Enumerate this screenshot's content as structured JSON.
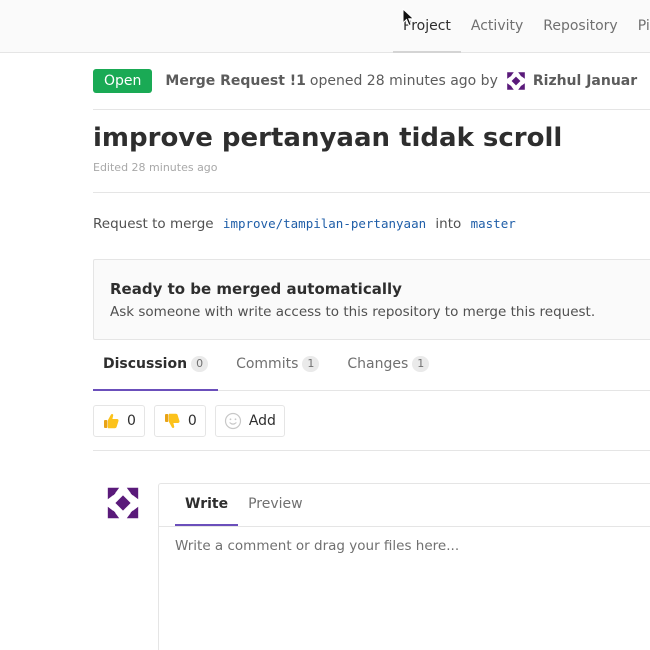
{
  "topnav": {
    "items": [
      {
        "label": "Project",
        "active": true
      },
      {
        "label": "Activity",
        "active": false
      },
      {
        "label": "Repository",
        "active": false
      },
      {
        "label": "Pipe",
        "active": false
      }
    ]
  },
  "mr": {
    "status": "Open",
    "ref": "Merge Request !1",
    "meta": "opened 28 minutes ago by",
    "author": "Rizhul Januar",
    "title": "improve pertanyaan tidak scroll",
    "edited": "Edited 28 minutes ago"
  },
  "merge_info": {
    "prefix": "Request to merge",
    "source_branch": "improve/tampilan-pertanyaan",
    "into": "into",
    "target_branch": "master"
  },
  "merge_widget": {
    "title": "Ready to be merged automatically",
    "description": "Ask someone with write access to this repository to merge this request."
  },
  "tabs": [
    {
      "label": "Discussion",
      "count": "0",
      "active": true
    },
    {
      "label": "Commits",
      "count": "1",
      "active": false
    },
    {
      "label": "Changes",
      "count": "1",
      "active": false
    }
  ],
  "awards": {
    "thumbs_up_count": "0",
    "thumbs_down_count": "0",
    "add_label": "Add"
  },
  "comment": {
    "write_tab": "Write",
    "preview_tab": "Preview",
    "placeholder": "Write a comment or drag your files here..."
  },
  "colors": {
    "accent": "#6b4fbb",
    "open_badge": "#1aaa55",
    "branch_link": "#1f5ea8"
  }
}
